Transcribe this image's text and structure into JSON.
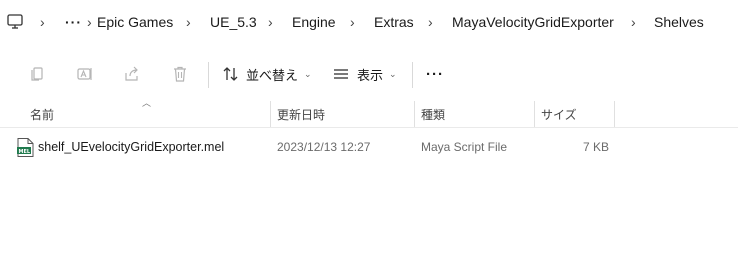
{
  "breadcrumb": {
    "overflow": "···",
    "items": [
      "Epic Games",
      "UE_5.3",
      "Engine",
      "Extras",
      "MayaVelocityGridExporter",
      "Shelves"
    ]
  },
  "toolbar": {
    "sort_label": "並べ替え",
    "view_label": "表示",
    "more_label": "···"
  },
  "columns": {
    "name": "名前",
    "date": "更新日時",
    "type": "種類",
    "size": "サイズ"
  },
  "files": [
    {
      "name": "shelf_UEvelocityGridExporter.mel",
      "date": "2023/12/13 12:27",
      "type": "Maya Script File",
      "size": "7 KB",
      "icon": "mel-file-icon",
      "icon_text": "MEL"
    }
  ],
  "colors": {
    "file_icon_green": "#1f7a4d"
  }
}
